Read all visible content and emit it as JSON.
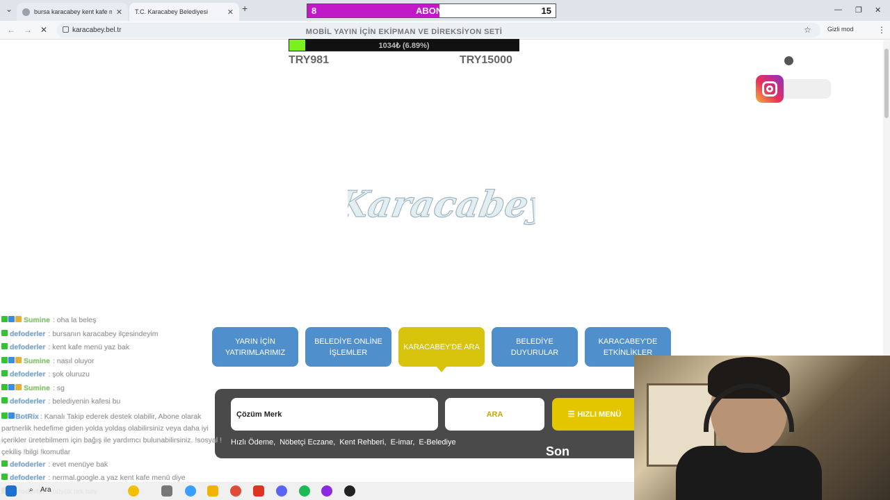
{
  "browser": {
    "tabs": [
      {
        "title": "bursa karacabey kent kafe menü"
      },
      {
        "title": "T.C. Karacabey Belediyesi"
      }
    ],
    "new_tab": "+",
    "url": "karacabey.bel.tr",
    "incognito_label": "Gizli mod"
  },
  "sub_counter": {
    "current": "8",
    "label": "ABONE",
    "target": "15",
    "progress": 0.533,
    "color": "#c118c8"
  },
  "donation_goal": {
    "title": "MOBİL YAYIN İÇİN EKİPMAN VE DİREKSİYON SETİ",
    "progress_text": "1034₺ (6.89%)",
    "progress": 0.0689,
    "min": "TRY981",
    "max": "TRY15000",
    "color": "#7cf01a"
  },
  "site": {
    "logo_text": "Karacabey",
    "nav_buttons": [
      {
        "label": "YARIN İÇİN YATIRIMLARIMIZ"
      },
      {
        "label": "BELEDİYE ONLİNE İŞLEMLER"
      },
      {
        "label": "KARACABEY'DE ARA"
      },
      {
        "label": "BELEDİYE DUYURULAR"
      },
      {
        "label": "KARACABEY'DE ETKİNLİKLER"
      }
    ],
    "active_color": "#d8c40c",
    "button_color": "#4f8fcb",
    "search": {
      "input_value": "Çözüm Merk",
      "button": "ARA",
      "quick_menu": "HIZLI MENÜ",
      "quick_menu_icon": "hamburger-icon",
      "quick_links": [
        "Hızlı Ödeme,",
        "Nöbetçi Eczane,",
        "Kent Rehberi,",
        "E-imar,",
        "E-Belediye"
      ],
      "ticker": "Son"
    }
  },
  "chat": [
    {
      "user": "Sumine",
      "msg": ": oha la beleş",
      "badges": 3
    },
    {
      "user": "defoderler",
      "msg": ": bursanın karacabey ilçesindeyim",
      "badges": 1
    },
    {
      "user": "defoderler",
      "msg": ": kent kafe menü yaz bak",
      "badges": 1
    },
    {
      "user": "Sumine",
      "msg": ": nasıl oluyor",
      "badges": 3
    },
    {
      "user": "defoderler",
      "msg": ": şok oluruzu",
      "badges": 1
    },
    {
      "user": "Sumine",
      "msg": ": sg",
      "badges": 3
    },
    {
      "user": "defoderler",
      "msg": ": belediyenin kafesi bu",
      "badges": 1
    },
    {
      "user": "BotRix",
      "msg": ": Kanalı Takip ederek destek olabilir, Abone olarak partnerlik hedefime giden yolda yoldaş olabilirsiniz veya daha iyi içerikler üretebilmem için bağış ile yardımcı bulunabilirsiniz. !sosyal !çekiliş !bilgi !komutlar",
      "badges": 2
    },
    {
      "user": "defoderler",
      "msg": ": evet menüye bak",
      "badges": 1
    },
    {
      "user": "defoderler",
      "msg": ": nermal.google.a yaz kent kafe menü diye",
      "badges": 1
    },
    {
      "user": "defoderler",
      "msg": ": büyük tek bay",
      "badges": 1
    }
  ],
  "taskbar": {
    "search_label": "Ara"
  }
}
